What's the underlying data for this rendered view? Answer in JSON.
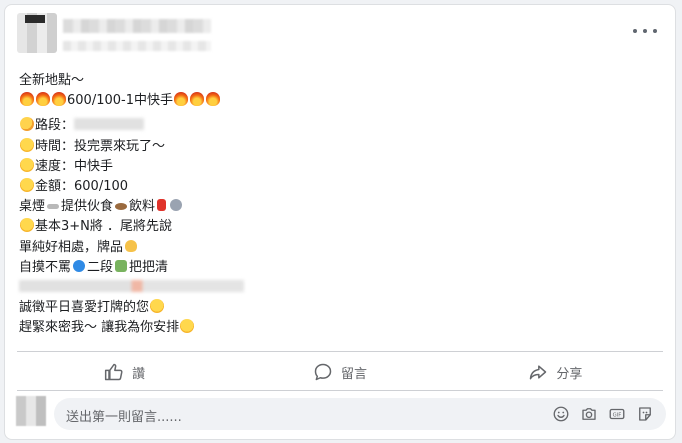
{
  "post": {
    "lines": {
      "title": "全新地點～",
      "headline": "600/100-1中快手",
      "road_label": "路段：",
      "time": "時間：投完票來玩了～",
      "speed": "速度：中快手",
      "amount": "金額：600/100",
      "table": "桌煙",
      "table_mid": "提供伙食",
      "table_end": "飲料",
      "basic": "基本3+N將 ．尾將先說",
      "simple": "單純好相處，牌品",
      "self": "自摸不罵",
      "self_mid": "二段",
      "self_end": "把把清",
      "sincere": "誠徵平日喜愛打牌的您",
      "hurry": "趕緊來密我～ 讓我為你安排"
    }
  },
  "actions": {
    "like": "讚",
    "comment": "留言",
    "share": "分享"
  },
  "comment_input": {
    "placeholder": "送出第一則留言......"
  },
  "icons": {
    "more": "more-dots-icon",
    "like": "thumbs-up-icon",
    "comment": "speech-bubble-icon",
    "share": "share-arrow-icon",
    "emoji": "smiley-icon",
    "camera": "camera-icon",
    "gif": "gif-icon",
    "sticker": "sticker-icon"
  },
  "colors": {
    "background": "#f0f2f5",
    "text": "#1c1e21",
    "muted": "#65676b",
    "divider": "#ced0d4"
  }
}
